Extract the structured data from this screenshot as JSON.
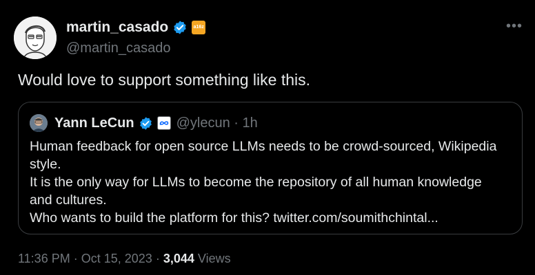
{
  "tweet": {
    "author": {
      "display_name": "martin_casado",
      "handle": "@martin_casado",
      "verified_icon": "verified-badge-icon",
      "affiliation_badge_text": "a16z",
      "affiliation_color": "#f5a623"
    },
    "more_label": "•••",
    "text": "Would love to support something like this.",
    "quoted": {
      "display_name": "Yann LeCun",
      "handle": "@ylecun",
      "separator": "·",
      "time_ago": "1h",
      "affiliation_icon": "meta-logo-icon",
      "lines": [
        "Human feedback for open source LLMs needs to be crowd-sourced, Wikipedia",
        "style.",
        "It is the only way for LLMs to become the repository of all human knowledge",
        "and cultures.",
        "Who wants to build the platform for this? twitter.com/soumithchintal..."
      ]
    },
    "footer": {
      "time": "11:36 PM",
      "sep1": "·",
      "date": "Oct 15, 2023",
      "sep2": "·",
      "views_count": "3,044",
      "views_label": "Views"
    }
  },
  "colors": {
    "background": "#000000",
    "text_primary": "#e7e9ea",
    "text_secondary": "#71767b",
    "verified_blue": "#1d9bf0",
    "border": "#3a3d40"
  }
}
